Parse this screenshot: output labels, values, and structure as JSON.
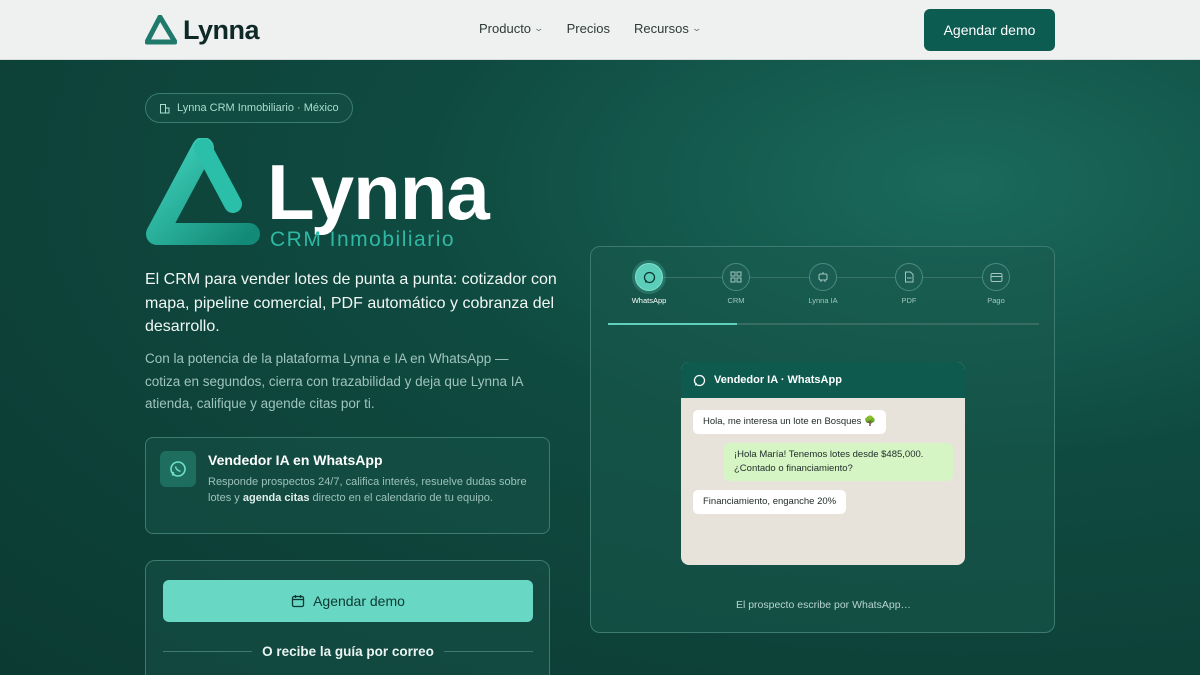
{
  "nav": {
    "logo_text": "Lynna",
    "links": [
      {
        "label": "Producto",
        "has_dropdown": true
      },
      {
        "label": "Precios",
        "has_dropdown": false
      },
      {
        "label": "Recursos",
        "has_dropdown": true
      }
    ],
    "cta_label": "Agendar demo"
  },
  "hero": {
    "badge": "Lynna CRM Inmobiliario · México",
    "logo_word": "Lynna",
    "logo_sub": "CRM Inmobiliario",
    "lead": "El CRM para vender lotes de punta a punta: cotizador con mapa, pipeline comercial, PDF automático y cobranza del desarrollo.",
    "sub": "Con la potencia de la plataforma Lynna e IA en WhatsApp — cotiza en segundos, cierra con trazabilidad y deja que Lynna IA atienda, califique y agende citas por ti."
  },
  "feature": {
    "title": "Vendedor IA en WhatsApp",
    "desc_part1": "Responde prospectos 24/7, califica interés, resuelve dudas sobre lotes y ",
    "desc_bold": "agenda citas",
    "desc_part2": " directo en el calendario de tu equipo."
  },
  "cta": {
    "button_label": "Agendar demo",
    "or_text": "O recibe la guía por correo"
  },
  "flow": {
    "steps": [
      {
        "label": "WhatsApp",
        "icon": "whatsapp-icon",
        "active": true
      },
      {
        "label": "CRM",
        "icon": "crm-icon",
        "active": false
      },
      {
        "label": "Lynna IA",
        "icon": "bot-icon",
        "active": false
      },
      {
        "label": "PDF",
        "icon": "pdf-icon",
        "active": false
      },
      {
        "label": "Pago",
        "icon": "card-icon",
        "active": false
      }
    ],
    "progress": 0.3,
    "chat_title": "Vendedor IA · WhatsApp",
    "messages": [
      {
        "from": "prospect",
        "text": "Hola, me interesa un lote en Bosques 🌳"
      },
      {
        "from": "agent",
        "text": "¡Hola María! Tenemos lotes desde $485,000. ¿Contado o financiamiento?"
      },
      {
        "from": "prospect",
        "text": "Financiamiento, enganche 20%"
      }
    ],
    "caption": "El prospecto escribe por WhatsApp…"
  },
  "colors": {
    "brand_dark": "#0d5c52",
    "accent": "#5ccdb8",
    "background": "#0d3d35"
  }
}
